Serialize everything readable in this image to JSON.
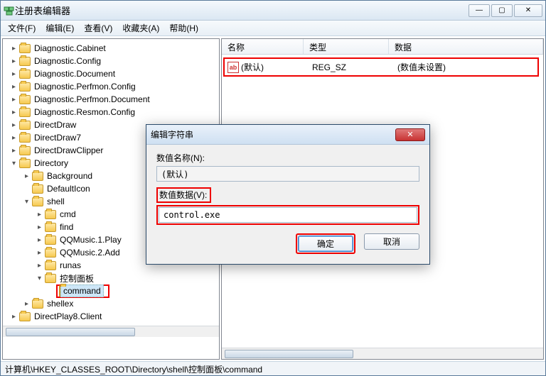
{
  "window": {
    "title": "注册表编辑器"
  },
  "menubar": {
    "file": "文件(F)",
    "edit": "编辑(E)",
    "view": "查看(V)",
    "favorites": "收藏夹(A)",
    "help": "帮助(H)"
  },
  "tree": {
    "items": [
      {
        "label": "Diagnostic.Cabinet",
        "depth": 2,
        "twisty": ">"
      },
      {
        "label": "Diagnostic.Config",
        "depth": 2,
        "twisty": ">"
      },
      {
        "label": "Diagnostic.Document",
        "depth": 2,
        "twisty": ">"
      },
      {
        "label": "Diagnostic.Perfmon.Config",
        "depth": 2,
        "twisty": ">"
      },
      {
        "label": "Diagnostic.Perfmon.Document",
        "depth": 2,
        "twisty": ">"
      },
      {
        "label": "Diagnostic.Resmon.Config",
        "depth": 2,
        "twisty": ">"
      },
      {
        "label": "DirectDraw",
        "depth": 2,
        "twisty": ">"
      },
      {
        "label": "DirectDraw7",
        "depth": 2,
        "twisty": ">"
      },
      {
        "label": "DirectDrawClipper",
        "depth": 2,
        "twisty": ">"
      },
      {
        "label": "Directory",
        "depth": 2,
        "twisty": "v"
      },
      {
        "label": "Background",
        "depth": 3,
        "twisty": ">"
      },
      {
        "label": "DefaultIcon",
        "depth": 3,
        "twisty": ""
      },
      {
        "label": "shell",
        "depth": 3,
        "twisty": "v"
      },
      {
        "label": "cmd",
        "depth": 4,
        "twisty": ">"
      },
      {
        "label": "find",
        "depth": 4,
        "twisty": ">"
      },
      {
        "label": "QQMusic.1.Play",
        "depth": 4,
        "twisty": ">"
      },
      {
        "label": "QQMusic.2.Add",
        "depth": 4,
        "twisty": ">"
      },
      {
        "label": "runas",
        "depth": 4,
        "twisty": ">"
      },
      {
        "label": "控制面板",
        "depth": 4,
        "twisty": "v"
      },
      {
        "label": "command",
        "depth": 5,
        "twisty": "",
        "selected": true,
        "highlight": true
      },
      {
        "label": "shellex",
        "depth": 3,
        "twisty": ">"
      },
      {
        "label": "DirectPlay8.Client",
        "depth": 2,
        "twisty": ">",
        "cut": true
      }
    ]
  },
  "list": {
    "columns": {
      "name": "名称",
      "type": "类型",
      "data": "数据"
    },
    "row": {
      "name": "(默认)",
      "type": "REG_SZ",
      "data": "(数值未设置)"
    }
  },
  "dialog": {
    "title": "编辑字符串",
    "name_label": "数值名称(N):",
    "name_value": "(默认)",
    "data_label": "数值数据(V):",
    "data_value": "control.exe",
    "ok": "确定",
    "cancel": "取消"
  },
  "statusbar": {
    "path": "计算机\\HKEY_CLASSES_ROOT\\Directory\\shell\\控制面板\\command"
  }
}
